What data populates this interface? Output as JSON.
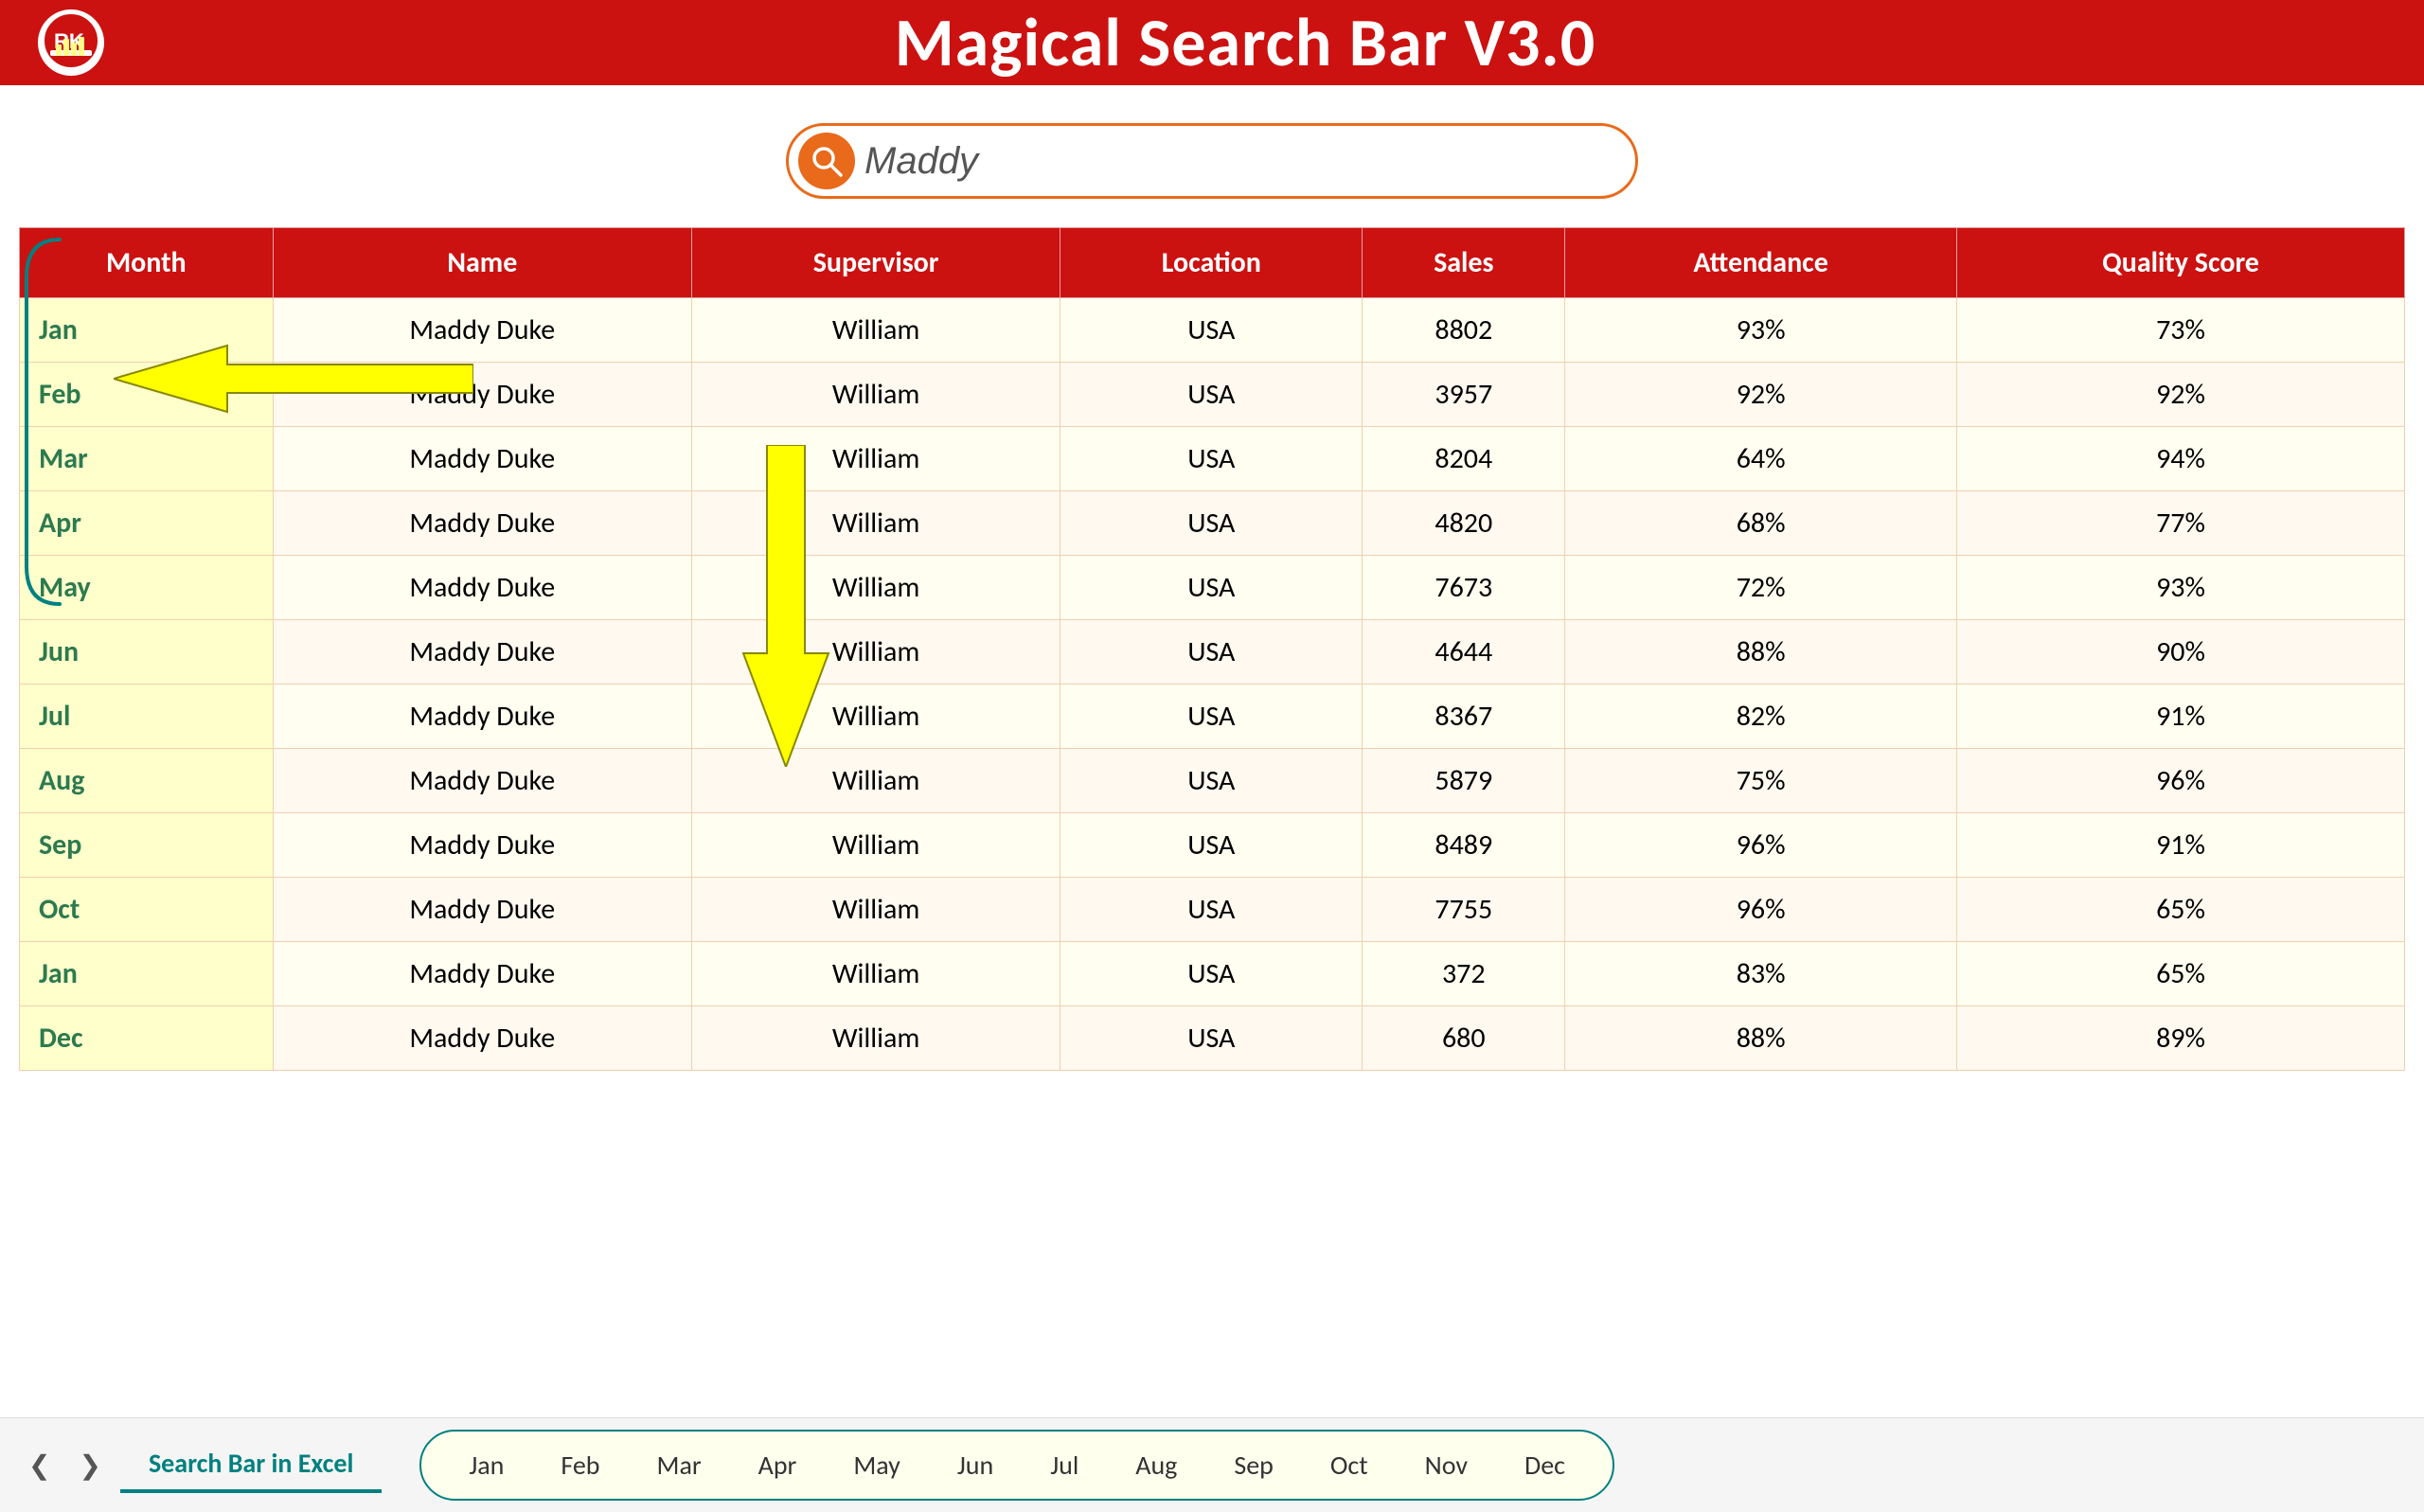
{
  "header": {
    "title": "Magical Search Bar V3.0",
    "logo_text": "RK"
  },
  "search": {
    "placeholder": "Maddy",
    "value": "Maddy"
  },
  "table": {
    "columns": [
      "Month",
      "Name",
      "Supervisor",
      "Location",
      "Sales",
      "Attendance",
      "Quality Score"
    ],
    "rows": [
      [
        "Jan",
        "Maddy Duke",
        "William",
        "USA",
        "8802",
        "93%",
        "73%"
      ],
      [
        "Feb",
        "Maddy Duke",
        "William",
        "USA",
        "3957",
        "92%",
        "92%"
      ],
      [
        "Mar",
        "Maddy Duke",
        "William",
        "USA",
        "8204",
        "64%",
        "94%"
      ],
      [
        "Apr",
        "Maddy Duke",
        "William",
        "USA",
        "4820",
        "68%",
        "77%"
      ],
      [
        "May",
        "Maddy Duke",
        "William",
        "USA",
        "7673",
        "72%",
        "93%"
      ],
      [
        "Jun",
        "Maddy Duke",
        "William",
        "USA",
        "4644",
        "88%",
        "90%"
      ],
      [
        "Jul",
        "Maddy Duke",
        "William",
        "USA",
        "8367",
        "82%",
        "91%"
      ],
      [
        "Aug",
        "Maddy Duke",
        "William",
        "USA",
        "5879",
        "75%",
        "96%"
      ],
      [
        "Sep",
        "Maddy Duke",
        "William",
        "USA",
        "8489",
        "96%",
        "91%"
      ],
      [
        "Oct",
        "Maddy Duke",
        "William",
        "USA",
        "7755",
        "96%",
        "65%"
      ],
      [
        "Jan",
        "Maddy Duke",
        "William",
        "USA",
        "372",
        "83%",
        "65%"
      ],
      [
        "Dec",
        "Maddy Duke",
        "William",
        "USA",
        "680",
        "88%",
        "89%"
      ]
    ]
  },
  "bottom": {
    "nav_prev": "❮",
    "nav_next": "❯",
    "active_sheet": "Search Bar in Excel",
    "months": [
      "Jan",
      "Feb",
      "Mar",
      "Apr",
      "May",
      "Jun",
      "Jul",
      "Aug",
      "Sep",
      "Oct",
      "Nov",
      "Dec"
    ]
  },
  "colors": {
    "header_bg": "#cc1111",
    "header_text": "#ffffff",
    "search_border": "#e86a1a",
    "search_icon_bg": "#e86a1a",
    "table_header_bg": "#cc1111",
    "month_col_bg": "#ffffcc",
    "month_col_text": "#2d7a4f",
    "teal": "#008080",
    "arrow_fill": "#ffff00",
    "arrow_stroke": "#888800"
  }
}
